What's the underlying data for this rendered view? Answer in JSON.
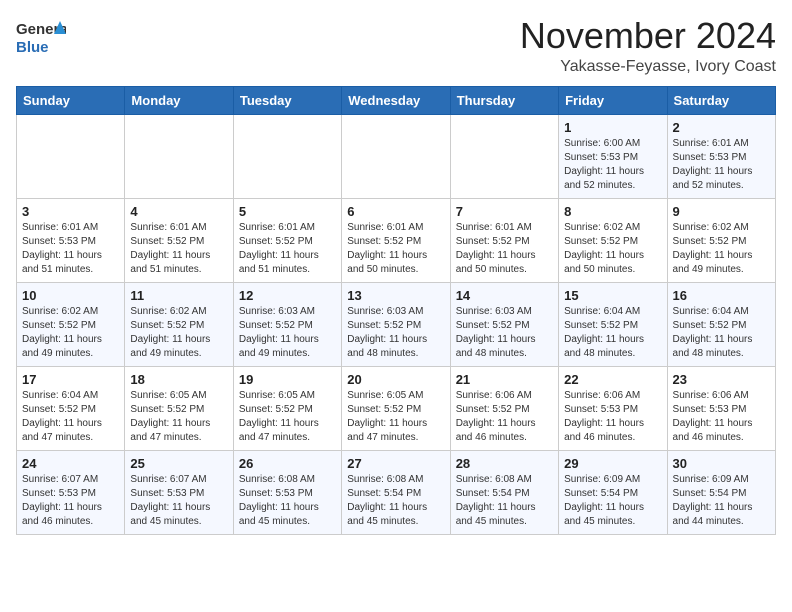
{
  "header": {
    "logo_general": "General",
    "logo_blue": "Blue",
    "month": "November 2024",
    "location": "Yakasse-Feyasse, Ivory Coast"
  },
  "weekdays": [
    "Sunday",
    "Monday",
    "Tuesday",
    "Wednesday",
    "Thursday",
    "Friday",
    "Saturday"
  ],
  "weeks": [
    [
      {
        "day": "",
        "info": ""
      },
      {
        "day": "",
        "info": ""
      },
      {
        "day": "",
        "info": ""
      },
      {
        "day": "",
        "info": ""
      },
      {
        "day": "",
        "info": ""
      },
      {
        "day": "1",
        "info": "Sunrise: 6:00 AM\nSunset: 5:53 PM\nDaylight: 11 hours\nand 52 minutes."
      },
      {
        "day": "2",
        "info": "Sunrise: 6:01 AM\nSunset: 5:53 PM\nDaylight: 11 hours\nand 52 minutes."
      }
    ],
    [
      {
        "day": "3",
        "info": "Sunrise: 6:01 AM\nSunset: 5:53 PM\nDaylight: 11 hours\nand 51 minutes."
      },
      {
        "day": "4",
        "info": "Sunrise: 6:01 AM\nSunset: 5:52 PM\nDaylight: 11 hours\nand 51 minutes."
      },
      {
        "day": "5",
        "info": "Sunrise: 6:01 AM\nSunset: 5:52 PM\nDaylight: 11 hours\nand 51 minutes."
      },
      {
        "day": "6",
        "info": "Sunrise: 6:01 AM\nSunset: 5:52 PM\nDaylight: 11 hours\nand 50 minutes."
      },
      {
        "day": "7",
        "info": "Sunrise: 6:01 AM\nSunset: 5:52 PM\nDaylight: 11 hours\nand 50 minutes."
      },
      {
        "day": "8",
        "info": "Sunrise: 6:02 AM\nSunset: 5:52 PM\nDaylight: 11 hours\nand 50 minutes."
      },
      {
        "day": "9",
        "info": "Sunrise: 6:02 AM\nSunset: 5:52 PM\nDaylight: 11 hours\nand 49 minutes."
      }
    ],
    [
      {
        "day": "10",
        "info": "Sunrise: 6:02 AM\nSunset: 5:52 PM\nDaylight: 11 hours\nand 49 minutes."
      },
      {
        "day": "11",
        "info": "Sunrise: 6:02 AM\nSunset: 5:52 PM\nDaylight: 11 hours\nand 49 minutes."
      },
      {
        "day": "12",
        "info": "Sunrise: 6:03 AM\nSunset: 5:52 PM\nDaylight: 11 hours\nand 49 minutes."
      },
      {
        "day": "13",
        "info": "Sunrise: 6:03 AM\nSunset: 5:52 PM\nDaylight: 11 hours\nand 48 minutes."
      },
      {
        "day": "14",
        "info": "Sunrise: 6:03 AM\nSunset: 5:52 PM\nDaylight: 11 hours\nand 48 minutes."
      },
      {
        "day": "15",
        "info": "Sunrise: 6:04 AM\nSunset: 5:52 PM\nDaylight: 11 hours\nand 48 minutes."
      },
      {
        "day": "16",
        "info": "Sunrise: 6:04 AM\nSunset: 5:52 PM\nDaylight: 11 hours\nand 48 minutes."
      }
    ],
    [
      {
        "day": "17",
        "info": "Sunrise: 6:04 AM\nSunset: 5:52 PM\nDaylight: 11 hours\nand 47 minutes."
      },
      {
        "day": "18",
        "info": "Sunrise: 6:05 AM\nSunset: 5:52 PM\nDaylight: 11 hours\nand 47 minutes."
      },
      {
        "day": "19",
        "info": "Sunrise: 6:05 AM\nSunset: 5:52 PM\nDaylight: 11 hours\nand 47 minutes."
      },
      {
        "day": "20",
        "info": "Sunrise: 6:05 AM\nSunset: 5:52 PM\nDaylight: 11 hours\nand 47 minutes."
      },
      {
        "day": "21",
        "info": "Sunrise: 6:06 AM\nSunset: 5:52 PM\nDaylight: 11 hours\nand 46 minutes."
      },
      {
        "day": "22",
        "info": "Sunrise: 6:06 AM\nSunset: 5:53 PM\nDaylight: 11 hours\nand 46 minutes."
      },
      {
        "day": "23",
        "info": "Sunrise: 6:06 AM\nSunset: 5:53 PM\nDaylight: 11 hours\nand 46 minutes."
      }
    ],
    [
      {
        "day": "24",
        "info": "Sunrise: 6:07 AM\nSunset: 5:53 PM\nDaylight: 11 hours\nand 46 minutes."
      },
      {
        "day": "25",
        "info": "Sunrise: 6:07 AM\nSunset: 5:53 PM\nDaylight: 11 hours\nand 45 minutes."
      },
      {
        "day": "26",
        "info": "Sunrise: 6:08 AM\nSunset: 5:53 PM\nDaylight: 11 hours\nand 45 minutes."
      },
      {
        "day": "27",
        "info": "Sunrise: 6:08 AM\nSunset: 5:54 PM\nDaylight: 11 hours\nand 45 minutes."
      },
      {
        "day": "28",
        "info": "Sunrise: 6:08 AM\nSunset: 5:54 PM\nDaylight: 11 hours\nand 45 minutes."
      },
      {
        "day": "29",
        "info": "Sunrise: 6:09 AM\nSunset: 5:54 PM\nDaylight: 11 hours\nand 45 minutes."
      },
      {
        "day": "30",
        "info": "Sunrise: 6:09 AM\nSunset: 5:54 PM\nDaylight: 11 hours\nand 44 minutes."
      }
    ]
  ]
}
